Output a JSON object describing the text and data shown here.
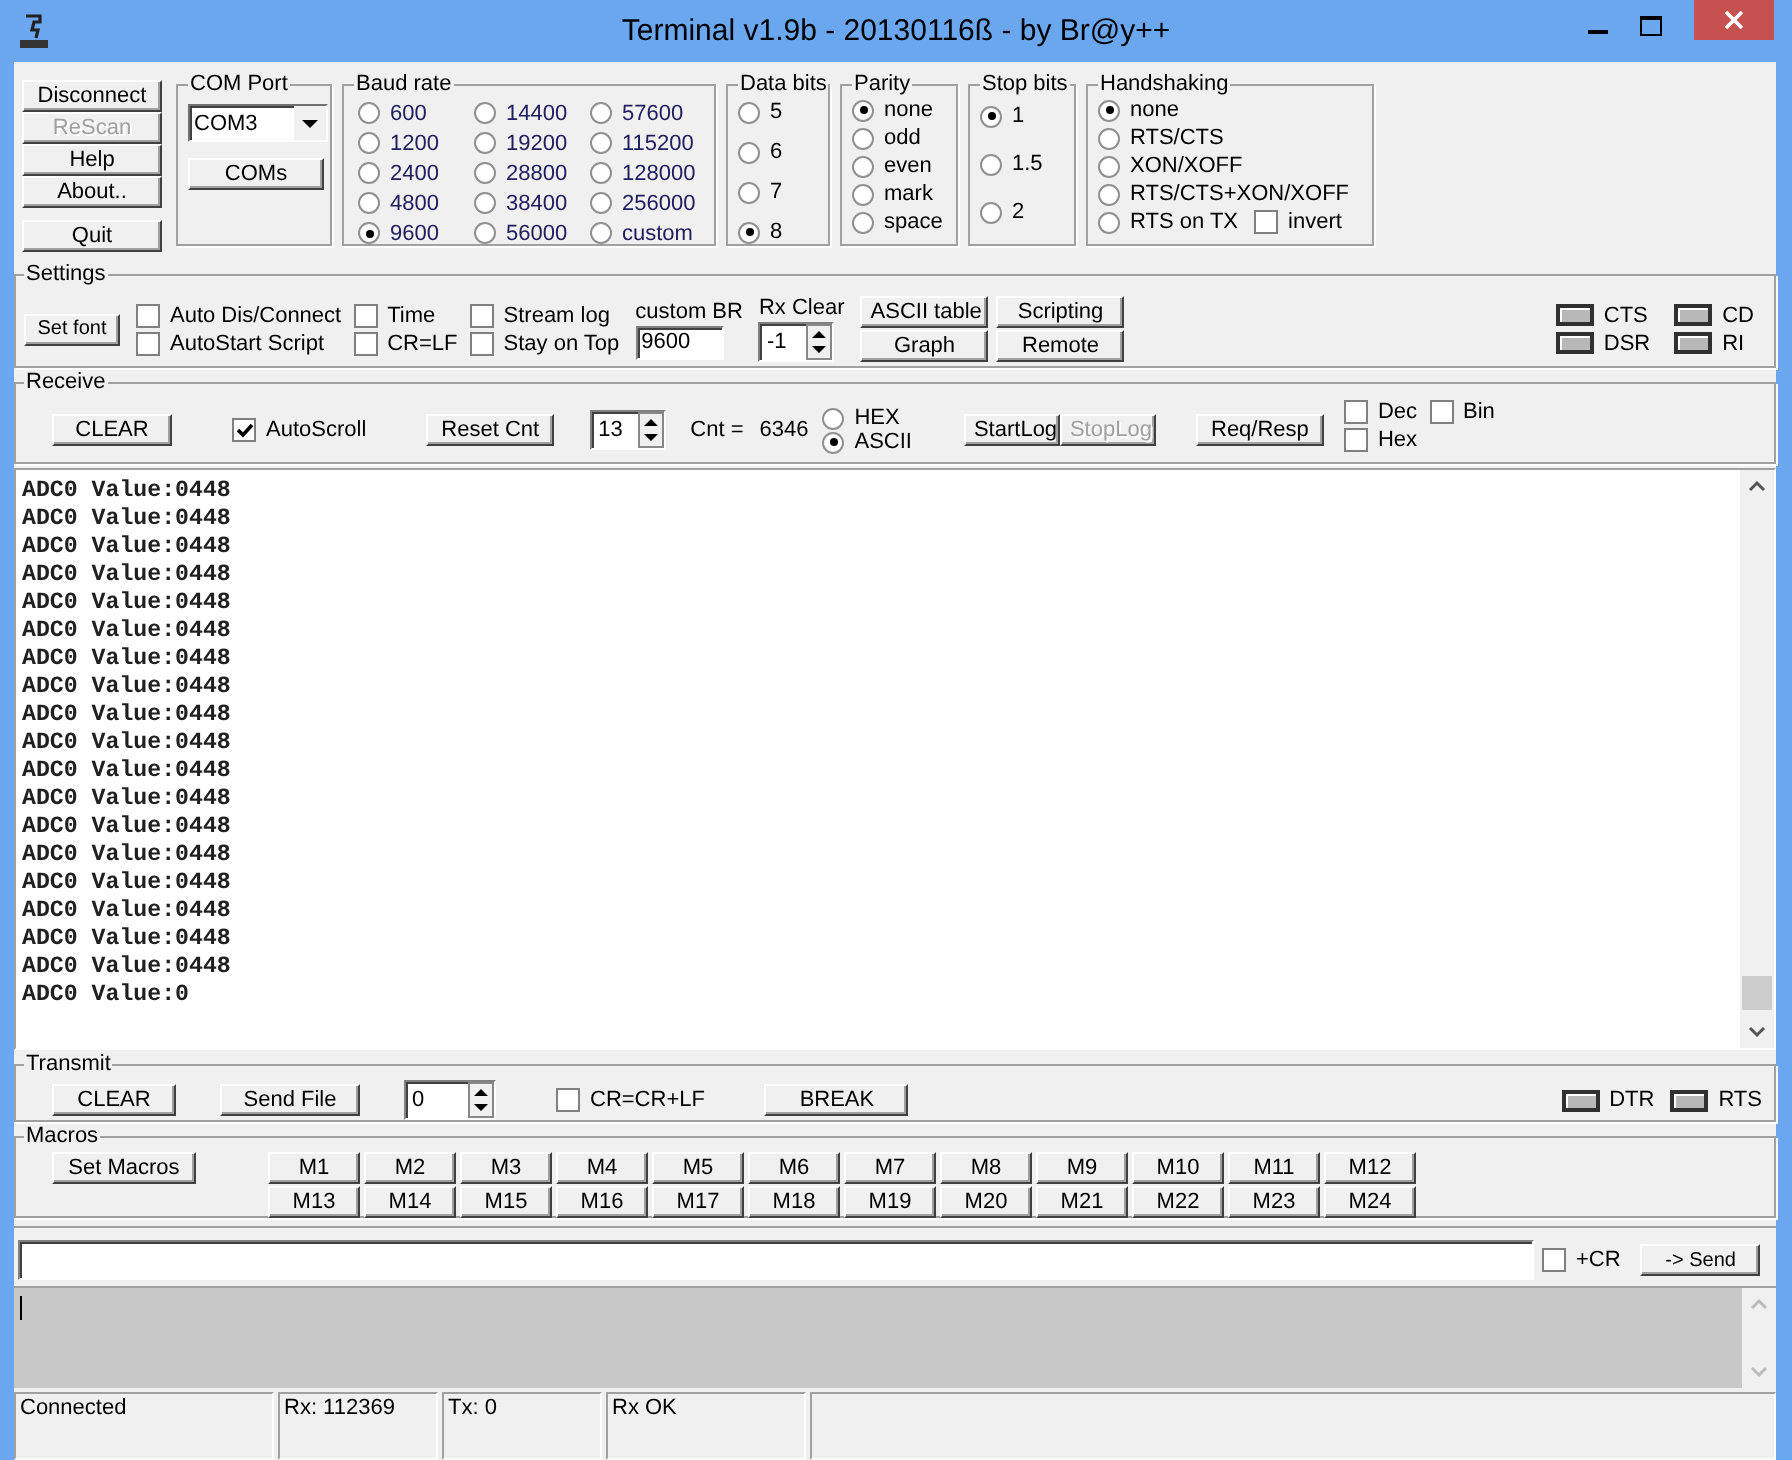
{
  "window": {
    "title": "Terminal v1.9b - 20130116ß - by Br@y++"
  },
  "top_buttons": [
    {
      "label": "Disconnect",
      "disabled": false
    },
    {
      "label": "ReScan",
      "disabled": true
    },
    {
      "label": "Help",
      "disabled": false
    },
    {
      "label": "About..",
      "disabled": false
    },
    {
      "label": "Quit",
      "disabled": false
    }
  ],
  "com_port": {
    "title": "COM Port",
    "value": "COM3",
    "button": "COMs"
  },
  "baud_rate": {
    "title": "Baud rate",
    "options": [
      {
        "label": "600",
        "selected": false
      },
      {
        "label": "1200",
        "selected": false
      },
      {
        "label": "2400",
        "selected": false
      },
      {
        "label": "4800",
        "selected": false
      },
      {
        "label": "9600",
        "selected": true
      },
      {
        "label": "14400",
        "selected": false
      },
      {
        "label": "19200",
        "selected": false
      },
      {
        "label": "28800",
        "selected": false
      },
      {
        "label": "38400",
        "selected": false
      },
      {
        "label": "56000",
        "selected": false
      },
      {
        "label": "57600",
        "selected": false
      },
      {
        "label": "115200",
        "selected": false
      },
      {
        "label": "128000",
        "selected": false
      },
      {
        "label": "256000",
        "selected": false
      },
      {
        "label": "custom",
        "selected": false
      }
    ]
  },
  "data_bits": {
    "title": "Data bits",
    "options": [
      {
        "label": "5",
        "selected": false
      },
      {
        "label": "6",
        "selected": false
      },
      {
        "label": "7",
        "selected": false
      },
      {
        "label": "8",
        "selected": true
      }
    ]
  },
  "parity": {
    "title": "Parity",
    "options": [
      {
        "label": "none",
        "selected": true
      },
      {
        "label": "odd",
        "selected": false
      },
      {
        "label": "even",
        "selected": false
      },
      {
        "label": "mark",
        "selected": false
      },
      {
        "label": "space",
        "selected": false
      }
    ]
  },
  "stop_bits": {
    "title": "Stop bits",
    "options": [
      {
        "label": "1",
        "selected": true
      },
      {
        "label": "1.5",
        "selected": false
      },
      {
        "label": "2",
        "selected": false
      }
    ]
  },
  "handshaking": {
    "title": "Handshaking",
    "options": [
      {
        "label": "none",
        "selected": true
      },
      {
        "label": "RTS/CTS",
        "selected": false
      },
      {
        "label": "XON/XOFF",
        "selected": false
      },
      {
        "label": "RTS/CTS+XON/XOFF",
        "selected": false
      },
      {
        "label": "RTS on TX",
        "selected": false
      }
    ],
    "invert": {
      "label": "invert",
      "checked": false
    }
  },
  "settings": {
    "title": "Settings",
    "set_font": "Set font",
    "checkboxes": [
      {
        "label": "Auto Dis/Connect",
        "checked": false
      },
      {
        "label": "Time",
        "checked": false
      },
      {
        "label": "Stream log",
        "checked": false
      },
      {
        "label": "AutoStart Script",
        "checked": false
      },
      {
        "label": "CR=LF",
        "checked": false
      },
      {
        "label": "Stay on Top",
        "checked": false
      }
    ],
    "custom_br": {
      "label": "custom BR",
      "value": "9600"
    },
    "rx_clear": {
      "label": "Rx Clear",
      "value": "-1"
    },
    "buttons": [
      "ASCII table",
      "Scripting",
      "Graph",
      "Remote"
    ],
    "leds": [
      {
        "label": "CTS",
        "on": false
      },
      {
        "label": "CD",
        "on": false
      },
      {
        "label": "DSR",
        "on": false
      },
      {
        "label": "RI",
        "on": false
      }
    ]
  },
  "receive": {
    "title": "Receive",
    "clear": "CLEAR",
    "autoscroll": {
      "label": "AutoScroll",
      "checked": true
    },
    "reset_cnt": "Reset Cnt",
    "spin_value": "13",
    "cnt_label": "Cnt =",
    "cnt_value": "6346",
    "modes": [
      {
        "label": "HEX",
        "selected": false
      },
      {
        "label": "ASCII",
        "selected": true
      }
    ],
    "log_buttons": [
      {
        "label": "StartLog",
        "disabled": false
      },
      {
        "label": "StopLog",
        "disabled": true
      }
    ],
    "req_resp": "Req/Resp",
    "formats": [
      {
        "label": "Dec",
        "checked": false
      },
      {
        "label": "Bin",
        "checked": false
      },
      {
        "label": "Hex",
        "checked": false
      }
    ]
  },
  "received_lines": [
    "ADC0 Value:0448",
    "ADC0 Value:0448",
    "ADC0 Value:0448",
    "ADC0 Value:0448",
    "ADC0 Value:0448",
    "ADC0 Value:0448",
    "ADC0 Value:0448",
    "ADC0 Value:0448",
    "ADC0 Value:0448",
    "ADC0 Value:0448",
    "ADC0 Value:0448",
    "ADC0 Value:0448",
    "ADC0 Value:0448",
    "ADC0 Value:0448",
    "ADC0 Value:0448",
    "ADC0 Value:0448",
    "ADC0 Value:0448",
    "ADC0 Value:0448",
    "ADC0 Value:0"
  ],
  "transmit": {
    "title": "Transmit",
    "clear": "CLEAR",
    "send_file": "Send File",
    "spin_value": "0",
    "cr_crlf": {
      "label": "CR=CR+LF",
      "checked": false
    },
    "break": "BREAK",
    "leds": [
      {
        "label": "DTR",
        "on": false
      },
      {
        "label": "RTS",
        "on": false
      }
    ]
  },
  "macros": {
    "title": "Macros",
    "set_macros": "Set Macros",
    "buttons": [
      "M1",
      "M2",
      "M3",
      "M4",
      "M5",
      "M6",
      "M7",
      "M8",
      "M9",
      "M10",
      "M11",
      "M12",
      "M13",
      "M14",
      "M15",
      "M16",
      "M17",
      "M18",
      "M19",
      "M20",
      "M21",
      "M22",
      "M23",
      "M24"
    ]
  },
  "send": {
    "plus_cr": {
      "label": "+CR",
      "checked": false
    },
    "button": "-> Send"
  },
  "status_bar": [
    "Connected",
    "Rx: 112369",
    "Tx: 0",
    "Rx OK"
  ]
}
